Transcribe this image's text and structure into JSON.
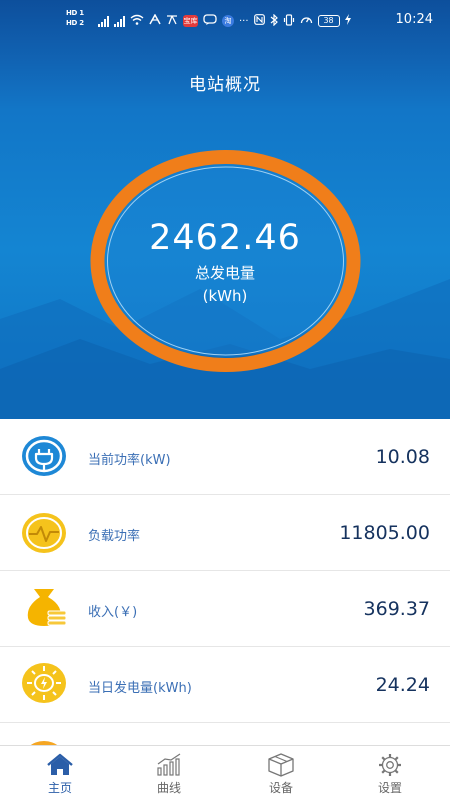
{
  "status_bar": {
    "sim1": "HD 1",
    "sim2": "HD 2",
    "app_badges": [
      "宝库",
      "淘"
    ],
    "battery": "38",
    "time": "10:24"
  },
  "header": {
    "title": "电站概况"
  },
  "gauge": {
    "value": "2462.46",
    "label": "总发电量",
    "unit": "(kWh)",
    "ring_color": "#f07e1a"
  },
  "stats": [
    {
      "icon": "plug-icon",
      "label": "当前功率(kW)",
      "value": "10.08"
    },
    {
      "icon": "load-wave-icon",
      "label": "负载功率",
      "value": "11805.00"
    },
    {
      "icon": "money-bag-icon",
      "label": "收入(￥)",
      "value": "369.37"
    },
    {
      "icon": "sun-bolt-icon",
      "label": "当日发电量(kWh)",
      "value": "24.24"
    }
  ],
  "bottom_nav": [
    {
      "icon": "home-icon",
      "label": "主页",
      "active": true
    },
    {
      "icon": "chart-icon",
      "label": "曲线",
      "active": false
    },
    {
      "icon": "box-icon",
      "label": "设备",
      "active": false
    },
    {
      "icon": "gear-icon",
      "label": "设置",
      "active": false
    }
  ],
  "colors": {
    "header_blue": "#1163b3",
    "accent_orange": "#f07e1a",
    "icon_yellow": "#f5c31c",
    "icon_blue": "#1e88d6",
    "value_text": "#15325e",
    "label_text": "#3b6fb5",
    "nav_active": "#2b5ea8"
  }
}
